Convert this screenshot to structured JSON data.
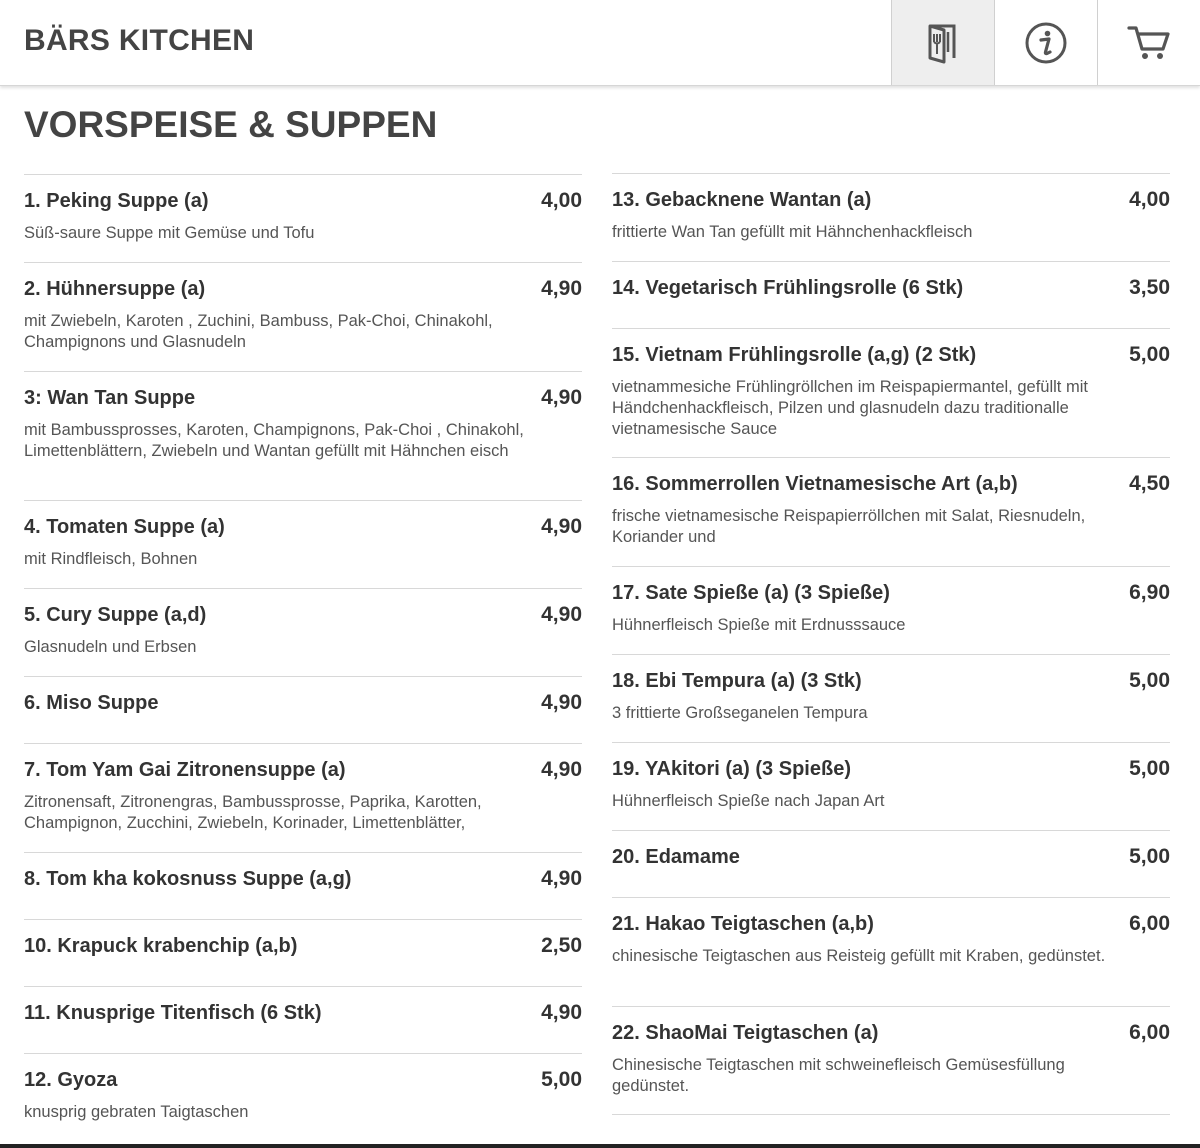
{
  "header": {
    "brand": "BÄRS KITCHEN",
    "nav": [
      {
        "icon": "menu-door-icon",
        "active": true
      },
      {
        "icon": "info-icon",
        "active": false
      },
      {
        "icon": "cart-icon",
        "active": false
      }
    ]
  },
  "section": {
    "title": "VORSPEISE & SUPPEN"
  },
  "menu": {
    "left": [
      {
        "name": "1. Peking Suppe (a)",
        "price": "4,00",
        "desc": "Süß-saure Suppe mit Gemüse und Tofu"
      },
      {
        "name": "2. Hühnersuppe (a)",
        "price": "4,90",
        "desc": "mit Zwiebeln, Karoten , Zuchini, Bambuss, Pak-Choi, Chinakohl, Champignons und Glasnudeln"
      },
      {
        "name": "3: Wan Tan Suppe",
        "price": "4,90",
        "desc": "mit Bambussprosses, Karoten, Champignons, Pak-Choi , Chinakohl, Limettenblättern, Zwiebeln und Wantan gefüllt mit Hähnchen eisch"
      },
      {
        "name": "4. Tomaten Suppe (a)",
        "price": "4,90",
        "desc": "mit Rindfleisch, Bohnen"
      },
      {
        "name": "5. Cury Suppe (a,d)",
        "price": "4,90",
        "desc": "Glasnudeln und Erbsen"
      },
      {
        "name": "6. Miso Suppe",
        "price": "4,90",
        "desc": ""
      },
      {
        "name": "7. Tom Yam Gai Zitronensuppe (a)",
        "price": "4,90",
        "desc": "Zitronensaft, Zitronengras, Bambussprosse, Paprika, Karotten, Champignon, Zucchini, Zwiebeln, Korinader, Limettenblätter,"
      },
      {
        "name": "8. Tom kha kokosnuss Suppe (a,g)",
        "price": "4,90",
        "desc": ""
      },
      {
        "name": "10. Krapuck krabenchip (a,b)",
        "price": "2,50",
        "desc": ""
      },
      {
        "name": "11. Knusprige Titenfisch (6 Stk)",
        "price": "4,90",
        "desc": ""
      },
      {
        "name": "12. Gyoza",
        "price": "5,00",
        "desc": "knusprig gebraten Taigtaschen"
      }
    ],
    "right": [
      {
        "name": "13. Gebacknene Wantan (a)",
        "price": "4,00",
        "desc": "frittierte Wan Tan gefüllt mit Hähnchenhackfleisch"
      },
      {
        "name": "14. Vegetarisch Frühlingsrolle (6 Stk)",
        "price": "3,50",
        "desc": ""
      },
      {
        "name": "15. Vietnam Frühlingsrolle (a,g) (2 Stk)",
        "price": "5,00",
        "desc": "vietnammesiche Frühlingröllchen im Reispapiermantel, gefüllt mit Händchenhackfleisch, Pilzen und glasnudeln dazu traditionalle vietnamesische Sauce"
      },
      {
        "name": "16. Sommerrollen Vietnamesische Art (a,b)",
        "price": "4,50",
        "desc": "frische vietnamesische Reispapierröllchen mit Salat, Riesnudeln, Koriander und"
      },
      {
        "name": "17. Sate Spieße (a) (3 Spieße)",
        "price": "6,90",
        "desc": "Hühnerfleisch Spieße mit Erdnusssauce"
      },
      {
        "name": "18. Ebi Tempura (a) (3 Stk)",
        "price": "5,00",
        "desc": "3 frittierte Großseganelen Tempura"
      },
      {
        "name": "19. YAkitori (a) (3 Spieße)",
        "price": "5,00",
        "desc": "Hühnerfleisch Spieße nach Japan Art"
      },
      {
        "name": "20. Edamame",
        "price": "5,00",
        "desc": ""
      },
      {
        "name": "21. Hakao Teigtaschen (a,b)",
        "price": "6,00",
        "desc": "chinesische Teigtaschen aus Reisteig gefüllt mit Kraben, gedünstet."
      },
      {
        "name": "22. ShaoMai Teigtaschen (a)",
        "price": "6,00",
        "desc": "Chinesische Teigtaschen mit schweinefleisch Gemüsesfüllung gedünstet."
      }
    ]
  }
}
